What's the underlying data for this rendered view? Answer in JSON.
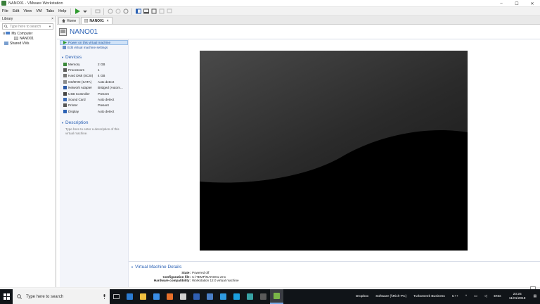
{
  "window": {
    "title": "NANO01 - VMware Workstation",
    "buttons": {
      "minimize": "–",
      "maximize": "☐",
      "close": "✕"
    }
  },
  "menubar": {
    "items": [
      "File",
      "Edit",
      "View",
      "VM",
      "Tabs",
      "Help"
    ]
  },
  "library": {
    "title": "Library",
    "close": "×",
    "search_placeholder": "Type here to search",
    "tree": {
      "root": "My Computer",
      "child": "NANO01",
      "shared": "Shared VMs"
    }
  },
  "tabs": [
    {
      "label": "Home"
    },
    {
      "label": "NANO01",
      "close": "×"
    }
  ],
  "vm": {
    "title": "NANO01",
    "actions": {
      "power_on": "Power on this virtual machine",
      "edit_settings": "Edit virtual machine settings"
    },
    "devices_title": "Devices",
    "devices": [
      {
        "name": "Memory",
        "value": "2 GB",
        "icon": "memory-icon",
        "color": "#3b8a3b"
      },
      {
        "name": "Processors",
        "value": "1",
        "icon": "processor-icon",
        "color": "#5a5a5a"
      },
      {
        "name": "Hard Disk (SCSI)",
        "value": "4 GB",
        "icon": "hard-disk-icon",
        "color": "#777777"
      },
      {
        "name": "CD/DVD (SATA)",
        "value": "Auto detect",
        "icon": "cd-dvd-icon",
        "color": "#8a8a8a"
      },
      {
        "name": "Network Adapter",
        "value": "Bridged (Autom...",
        "icon": "network-adapter-icon",
        "color": "#2b5aa8"
      },
      {
        "name": "USB Controller",
        "value": "Present",
        "icon": "usb-icon",
        "color": "#444444"
      },
      {
        "name": "Sound Card",
        "value": "Auto detect",
        "icon": "sound-card-icon",
        "color": "#3a6ab5"
      },
      {
        "name": "Printer",
        "value": "Present",
        "icon": "printer-icon",
        "color": "#555555"
      },
      {
        "name": "Display",
        "value": "Auto detect",
        "icon": "display-icon",
        "color": "#2c62b5"
      }
    ],
    "description_title": "Description",
    "description_placeholder": "Type here to enter a description of this virtual machine.",
    "details_title": "Virtual Machine Details",
    "details": [
      {
        "key": "State:",
        "value": "Powered off"
      },
      {
        "key": "Configuration file:",
        "value": "C:\\TEMP\\NANO01.vmx"
      },
      {
        "key": "Hardware compatibility:",
        "value": "Workstation 12.0 virtual machine"
      }
    ]
  },
  "taskbar": {
    "search_placeholder": "Type here to search",
    "apps": [
      {
        "name": "edge",
        "color": "#2b7cd3"
      },
      {
        "name": "file-explorer",
        "color": "#f0c040"
      },
      {
        "name": "store",
        "color": "#3a8ee6"
      },
      {
        "name": "firefox",
        "color": "#e8702a"
      },
      {
        "name": "mail",
        "color": "#d0d0d0"
      },
      {
        "name": "app-blue",
        "color": "#2f5fb3"
      },
      {
        "name": "photos",
        "color": "#4a7fc7"
      },
      {
        "name": "app-cloud",
        "color": "#2f9be0"
      },
      {
        "name": "skype",
        "color": "#1aa0e0"
      },
      {
        "name": "app-teal",
        "color": "#38a3a5"
      },
      {
        "name": "app-terminal",
        "color": "#5a5a5a"
      },
      {
        "name": "vmware",
        "color": "#7ab648"
      }
    ],
    "tray": [
      "Dropbox",
      "Software (\\\\Rich-PC)",
      "TurboGeek Business",
      "C++",
      "ENG"
    ],
    "clock_time": "23:25",
    "clock_date": "11/01/2018"
  },
  "colors": {
    "accent": "#2c62b5",
    "taskbar": "#101418"
  }
}
